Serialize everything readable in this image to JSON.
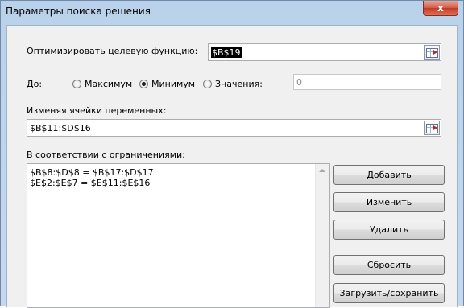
{
  "window": {
    "title": "Параметры поиска решения",
    "close_glyph": "x"
  },
  "objective": {
    "label": "Оптимизировать целевую функцию:",
    "value": "$B$19"
  },
  "to": {
    "label": "До:",
    "options": [
      {
        "label": "Максимум",
        "selected": false
      },
      {
        "label": "Минимум",
        "selected": true
      },
      {
        "label": "Значения:",
        "selected": false
      }
    ],
    "value_field": "0"
  },
  "variables": {
    "label": "Изменяя ячейки переменных:",
    "value": "$B$11:$D$16"
  },
  "constraints": {
    "label": "В соответствии с ограничениями:",
    "items": [
      "$B$8:$D$8 = $B$17:$D$17",
      "$E$2:$E$7 = $E$11:$E$16"
    ]
  },
  "buttons": {
    "add": "Добавить",
    "change": "Изменить",
    "delete": "Удалить",
    "reset": "Сбросить",
    "load_save": "Загрузить/сохранить"
  }
}
